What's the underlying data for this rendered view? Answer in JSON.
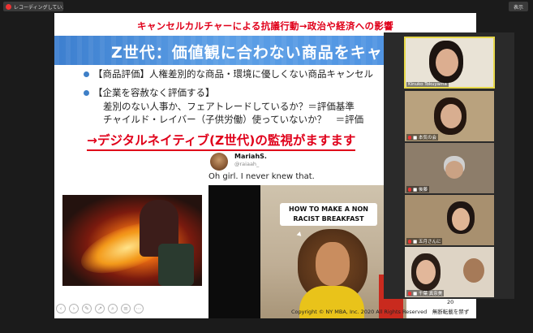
{
  "topbar": {
    "recording_label": "レコーディングしています...",
    "view_button": "表示"
  },
  "slide": {
    "top_heading": "キャンセルカルチャーによる抗議行動→政治や経済への影響",
    "title": "Z世代：価値観に合わない商品をキャンセル",
    "bullet1": "【商品評価】人権差別的な商品・環境に優しくない商品キャンセル",
    "bullet2": "【企業を容赦なく評価する】",
    "sub1": "差別のない人事か、フェアトレードしているか？＝評価基準",
    "sub2": "チャイルド・レイバー（子供労働）使っていないか？　＝評価",
    "red_line": "→デジタルネイティブ(Z世代)の監視がますます",
    "tweet": {
      "name": "MariahS.",
      "handle": "@raiaah_",
      "text": "Oh girl. I never knew that."
    },
    "video_caption": "HOW TO MAKE A NON RACIST BREAKFAST",
    "footer": "Copyright © NY MBA, Inc. 2020 All Rights Reserved　無断転載を禁ず",
    "page_number": "20",
    "nav_icons": [
      "prev-icon",
      "next-icon",
      "pen-icon",
      "pointer-icon",
      "zoom-icon",
      "menu-icon",
      "more-icon"
    ]
  },
  "participants": [
    {
      "name": "Kinuko Tokuyama",
      "muted": false,
      "active": true
    },
    {
      "name": "■ 本気の会",
      "muted": true,
      "active": false
    },
    {
      "name": "■ 後藤",
      "muted": true,
      "active": false
    },
    {
      "name": "■ 五月さんに",
      "muted": true,
      "active": false
    },
    {
      "name": "■ 千葉 真奈美",
      "muted": true,
      "active": false
    }
  ],
  "colors": {
    "accent_red": "#e0001a",
    "title_blue": "#4a8ee0",
    "active_speaker": "#e6d84a"
  }
}
